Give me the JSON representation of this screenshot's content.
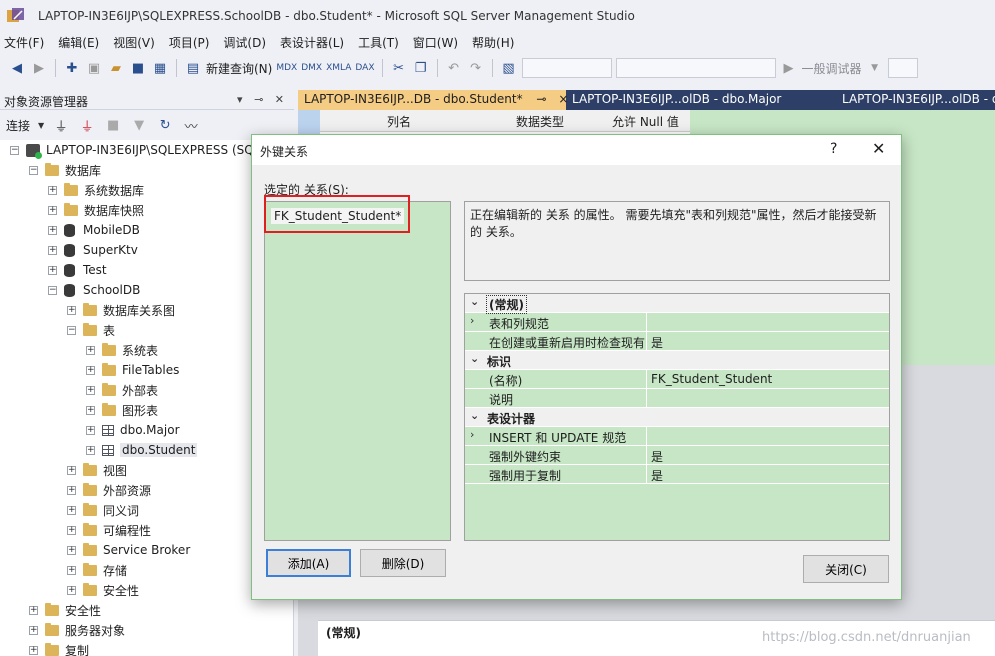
{
  "window": {
    "title": "LAPTOP-IN3E6IJP\\SQLEXPRESS.SchoolDB - dbo.Student* - Microsoft SQL Server Management Studio"
  },
  "menu": [
    "文件(F)",
    "编辑(E)",
    "视图(V)",
    "项目(P)",
    "调试(D)",
    "表设计器(L)",
    "工具(T)",
    "窗口(W)",
    "帮助(H)"
  ],
  "toolbar": {
    "new_query": "新建查询(N)",
    "debugger": "一般调试器"
  },
  "object_explorer": {
    "title": "对象资源管理器",
    "connect": "连接",
    "server": "LAPTOP-IN3E6IJP\\SQLEXPRESS (SQ",
    "nodes": [
      {
        "label": "数据库",
        "type": "folder",
        "level": 1,
        "expanded": true
      },
      {
        "label": "系统数据库",
        "type": "folder",
        "level": 2,
        "expanded": false
      },
      {
        "label": "数据库快照",
        "type": "folder",
        "level": 2,
        "expanded": false
      },
      {
        "label": "MobileDB",
        "type": "db",
        "level": 2,
        "expanded": false
      },
      {
        "label": "SuperKtv",
        "type": "db",
        "level": 2,
        "expanded": false
      },
      {
        "label": "Test",
        "type": "db",
        "level": 2,
        "expanded": false
      },
      {
        "label": "SchoolDB",
        "type": "db",
        "level": 2,
        "expanded": true
      },
      {
        "label": "数据库关系图",
        "type": "folder",
        "level": 3,
        "expanded": false
      },
      {
        "label": "表",
        "type": "folder",
        "level": 3,
        "expanded": true
      },
      {
        "label": "系统表",
        "type": "folder",
        "level": 4,
        "expanded": false
      },
      {
        "label": "FileTables",
        "type": "folder",
        "level": 4,
        "expanded": false
      },
      {
        "label": "外部表",
        "type": "folder",
        "level": 4,
        "expanded": false
      },
      {
        "label": "图形表",
        "type": "folder",
        "level": 4,
        "expanded": false
      },
      {
        "label": "dbo.Major",
        "type": "table",
        "level": 4,
        "expanded": false
      },
      {
        "label": "dbo.Student",
        "type": "table",
        "level": 4,
        "expanded": false,
        "selected": true
      },
      {
        "label": "视图",
        "type": "folder",
        "level": 3,
        "expanded": false
      },
      {
        "label": "外部资源",
        "type": "folder",
        "level": 3,
        "expanded": false
      },
      {
        "label": "同义词",
        "type": "folder",
        "level": 3,
        "expanded": false
      },
      {
        "label": "可编程性",
        "type": "folder",
        "level": 3,
        "expanded": false
      },
      {
        "label": "Service Broker",
        "type": "folder",
        "level": 3,
        "expanded": false
      },
      {
        "label": "存储",
        "type": "folder",
        "level": 3,
        "expanded": false
      },
      {
        "label": "安全性",
        "type": "folder",
        "level": 3,
        "expanded": false
      },
      {
        "label": "安全性",
        "type": "folder",
        "level": 1,
        "expanded": false
      },
      {
        "label": "服务器对象",
        "type": "folder",
        "level": 1,
        "expanded": false
      },
      {
        "label": "复制",
        "type": "folder",
        "level": 1,
        "expanded": false
      }
    ]
  },
  "tabs": [
    {
      "label": "LAPTOP-IN3E6IJP...DB - dbo.Student*",
      "pin": "⊸",
      "close": "×"
    },
    {
      "label": "LAPTOP-IN3E6IJP...olDB - dbo.Major"
    },
    {
      "label": "LAPTOP-IN3E6IJP...olDB - d"
    }
  ],
  "designer": {
    "col_name": "列名",
    "col_type": "数据类型",
    "col_null": "允许 Null 值",
    "properties_section": "(常规)"
  },
  "dialog": {
    "title": "外键关系",
    "help": "?",
    "close_glyph": "✕",
    "list_label": "选定的 关系(S):",
    "relationship": "FK_Student_Student*",
    "description": "正在编辑新的 关系 的属性。 需要先填充\"表和列规范\"属性，然后才能接受新的 关系。",
    "grid": [
      {
        "kind": "cat",
        "name": "(常规)"
      },
      {
        "kind": "prop",
        "name": "表和列规范",
        "value": "",
        "expandable": true
      },
      {
        "kind": "prop",
        "name": "在创建或重新启用时检查现有",
        "value": "是"
      },
      {
        "kind": "cat",
        "name": "标识"
      },
      {
        "kind": "prop",
        "name": "(名称)",
        "value": "FK_Student_Student"
      },
      {
        "kind": "prop",
        "name": "说明",
        "value": ""
      },
      {
        "kind": "cat",
        "name": "表设计器"
      },
      {
        "kind": "prop",
        "name": "INSERT 和 UPDATE 规范",
        "value": "",
        "expandable": true
      },
      {
        "kind": "prop",
        "name": "强制外键约束",
        "value": "是"
      },
      {
        "kind": "prop",
        "name": "强制用于复制",
        "value": "是"
      }
    ],
    "add_button": "添加(A)",
    "delete_button": "删除(D)",
    "close_button": "关闭(C)"
  },
  "watermark": "https://blog.csdn.net/dnruanjian",
  "colors": {
    "chrome": "#eef0f5",
    "tab_active": "#f5cc84",
    "tab_strip": "#2d3f66",
    "grid_green": "#c6e6c5",
    "highlight_red": "#e02020"
  }
}
